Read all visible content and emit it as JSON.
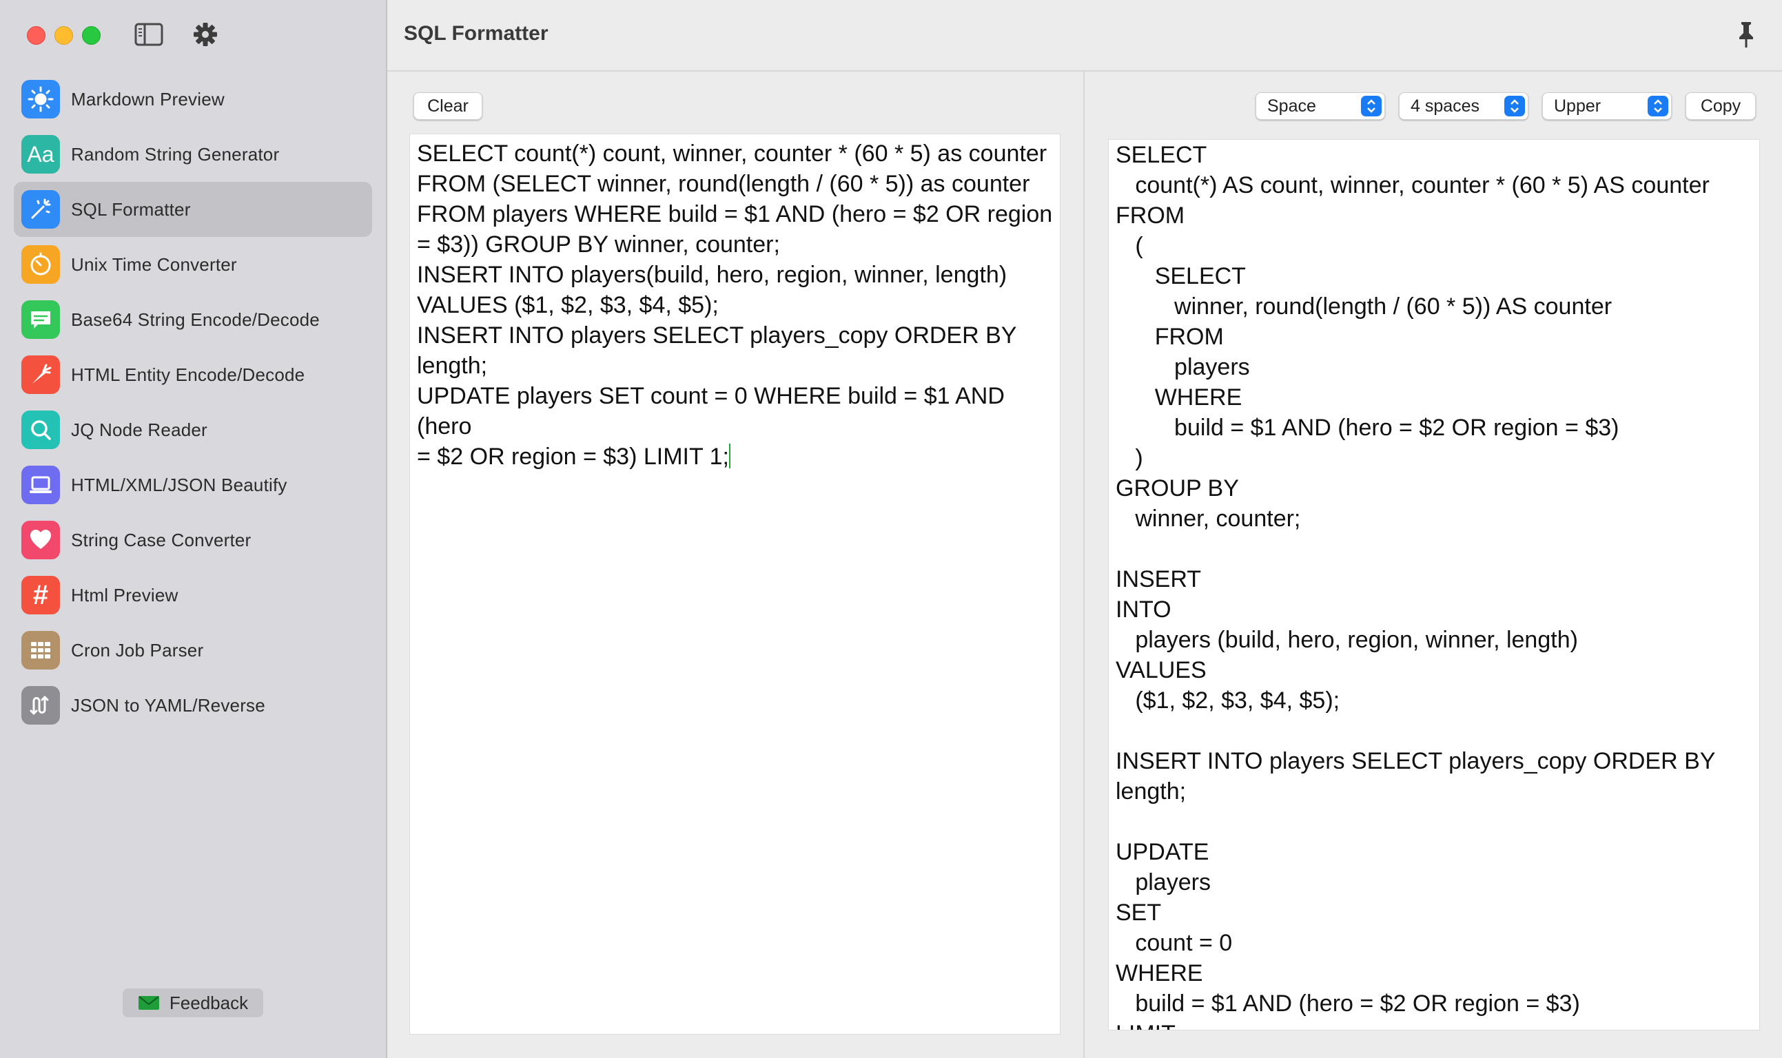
{
  "app": {
    "title": "SQL Formatter"
  },
  "sidebar": {
    "items": [
      {
        "label": "Markdown Preview",
        "icon": "sun-icon",
        "color": "#2f8cf6"
      },
      {
        "label": "Random String Generator",
        "icon": "aa-text-icon",
        "color": "#2bb7a3"
      },
      {
        "label": "SQL Formatter",
        "icon": "magic-wand-icon",
        "color": "#2f8cf6",
        "active": true
      },
      {
        "label": "Unix Time Converter",
        "icon": "timer-icon",
        "color": "#f6a623"
      },
      {
        "label": "Base64 String Encode/Decode",
        "icon": "message-icon",
        "color": "#34c759"
      },
      {
        "label": "HTML Entity Encode/Decode",
        "icon": "carrot-icon",
        "color": "#f4513e"
      },
      {
        "label": "JQ Node Reader",
        "icon": "magnifier-icon",
        "color": "#24c2b5"
      },
      {
        "label": "HTML/XML/JSON Beautify",
        "icon": "laptop-icon",
        "color": "#6e6cf0"
      },
      {
        "label": "String Case Converter",
        "icon": "heart-icon",
        "color": "#f2486b"
      },
      {
        "label": "Html Preview",
        "icon": "hash-icon",
        "color": "#f4513e"
      },
      {
        "label": "Cron Job Parser",
        "icon": "grid-icon",
        "color": "#b3926a"
      },
      {
        "label": "JSON to YAML/Reverse",
        "icon": "swap-icon",
        "color": "#8e8e93"
      }
    ],
    "feedback_label": "Feedback"
  },
  "input_pane": {
    "clear_label": "Clear",
    "text": "SELECT count(*) count, winner, counter * (60 * 5) as counter\nFROM (SELECT winner, round(length / (60 * 5)) as counter\nFROM players WHERE build = $1 AND (hero = $2 OR region\n= $3)) GROUP BY winner, counter;\nINSERT INTO players(build, hero, region, winner, length)\nVALUES ($1, $2, $3, $4, $5);\nINSERT INTO players SELECT players_copy ORDER BY\nlength;\nUPDATE players SET count = 0 WHERE build = $1 AND (hero\n= $2 OR region = $3) LIMIT 1;"
  },
  "output_pane": {
    "indent_type": "Space",
    "indent_size": "4 spaces",
    "case": "Upper",
    "copy_label": "Copy",
    "text": "SELECT\n   count(*) AS count, winner, counter * (60 * 5) AS counter\nFROM\n   (\n      SELECT\n         winner, round(length / (60 * 5)) AS counter\n      FROM\n         players\n      WHERE\n         build = $1 AND (hero = $2 OR region = $3)\n   )\nGROUP BY\n   winner, counter;\n\nINSERT\nINTO\n   players (build, hero, region, winner, length)\nVALUES\n   ($1, $2, $3, $4, $5);\n\nINSERT INTO players SELECT players_copy ORDER BY\nlength;\n\nUPDATE\n   players\nSET\n   count = 0\nWHERE\n   build = $1 AND (hero = $2 OR region = $3)\nLIMIT"
  },
  "colors": {
    "accent": "#1a7cf5",
    "caret": "#1faa3a"
  }
}
